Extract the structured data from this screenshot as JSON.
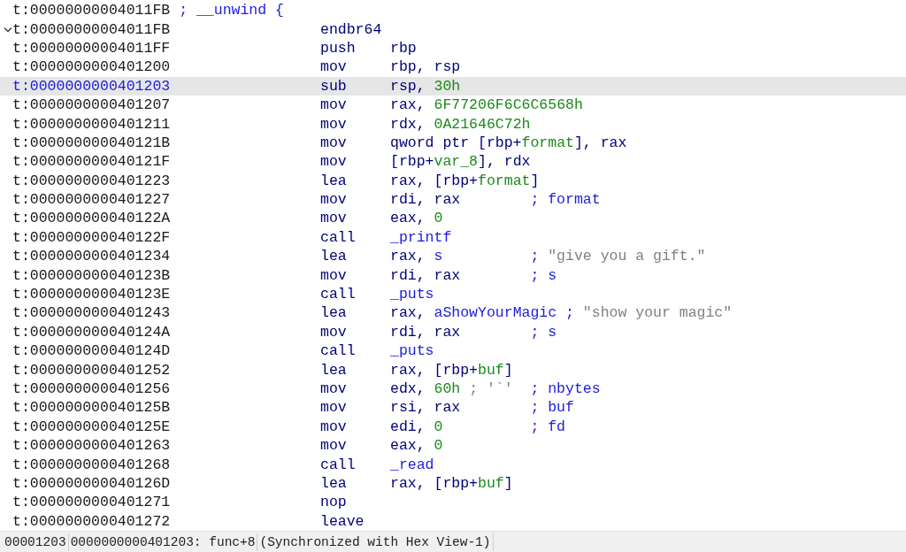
{
  "header": {
    "address": "t:00000000004011FB",
    "comment": "; __unwind {"
  },
  "lines": [
    {
      "address": "t:00000000004011FB",
      "selected": false,
      "expanded": true,
      "mnemonic": "endbr64"
    },
    {
      "address": "t:00000000004011FF",
      "selected": false,
      "mnemonic": "push",
      "operands": [
        {
          "text": "rbp",
          "kind": "reg"
        }
      ]
    },
    {
      "address": "t:0000000000401200",
      "selected": false,
      "mnemonic": "mov",
      "operands": [
        {
          "text": "rbp, rsp",
          "kind": "reg"
        }
      ]
    },
    {
      "address": "t:0000000000401203",
      "selected": true,
      "mnemonic": "sub",
      "operands": [
        {
          "text": "rsp, ",
          "kind": "reg"
        },
        {
          "text": "30h",
          "kind": "num"
        }
      ]
    },
    {
      "address": "t:0000000000401207",
      "selected": false,
      "mnemonic": "mov",
      "operands": [
        {
          "text": "rax, ",
          "kind": "reg"
        },
        {
          "text": "6F77206F6C6C6568h",
          "kind": "num"
        }
      ]
    },
    {
      "address": "t:0000000000401211",
      "selected": false,
      "mnemonic": "mov",
      "operands": [
        {
          "text": "rdx, ",
          "kind": "reg"
        },
        {
          "text": "0A21646C72h",
          "kind": "num"
        }
      ]
    },
    {
      "address": "t:000000000040121B",
      "selected": false,
      "mnemonic": "mov",
      "operands": [
        {
          "text": "qword ptr [rbp+",
          "kind": "reg"
        },
        {
          "text": "format",
          "kind": "num"
        },
        {
          "text": "], rax",
          "kind": "reg"
        }
      ]
    },
    {
      "address": "t:000000000040121F",
      "selected": false,
      "mnemonic": "mov",
      "operands": [
        {
          "text": "[rbp+",
          "kind": "reg"
        },
        {
          "text": "var_8",
          "kind": "num"
        },
        {
          "text": "], rdx",
          "kind": "reg"
        }
      ]
    },
    {
      "address": "t:0000000000401223",
      "selected": false,
      "mnemonic": "lea",
      "operands": [
        {
          "text": "rax, [rbp+",
          "kind": "reg"
        },
        {
          "text": "format",
          "kind": "num"
        },
        {
          "text": "]",
          "kind": "reg"
        }
      ]
    },
    {
      "address": "t:0000000000401227",
      "selected": false,
      "mnemonic": "mov",
      "operands": [
        {
          "text": "rdi, rax",
          "kind": "reg"
        }
      ],
      "comment": [
        {
          "text": "; format",
          "kind": "ref"
        }
      ]
    },
    {
      "address": "t:000000000040122A",
      "selected": false,
      "mnemonic": "mov",
      "operands": [
        {
          "text": "eax, ",
          "kind": "reg"
        },
        {
          "text": "0",
          "kind": "num"
        }
      ]
    },
    {
      "address": "t:000000000040122F",
      "selected": false,
      "mnemonic": "call",
      "operands": [
        {
          "text": "_printf",
          "kind": "sym"
        }
      ]
    },
    {
      "address": "t:0000000000401234",
      "selected": false,
      "mnemonic": "lea",
      "operands": [
        {
          "text": "rax, ",
          "kind": "reg"
        },
        {
          "text": "s",
          "kind": "sym"
        }
      ],
      "comment": [
        {
          "text": "; ",
          "kind": "ref"
        },
        {
          "text": "\"give you a gift.\"",
          "kind": "str"
        }
      ]
    },
    {
      "address": "t:000000000040123B",
      "selected": false,
      "mnemonic": "mov",
      "operands": [
        {
          "text": "rdi, rax",
          "kind": "reg"
        }
      ],
      "comment": [
        {
          "text": "; s",
          "kind": "ref"
        }
      ]
    },
    {
      "address": "t:000000000040123E",
      "selected": false,
      "mnemonic": "call",
      "operands": [
        {
          "text": "_puts",
          "kind": "sym"
        }
      ]
    },
    {
      "address": "t:0000000000401243",
      "selected": false,
      "mnemonic": "lea",
      "operands": [
        {
          "text": "rax, ",
          "kind": "reg"
        },
        {
          "text": "aShowYourMagic",
          "kind": "sym"
        }
      ],
      "comment": [
        {
          "text": "; ",
          "kind": "ref"
        },
        {
          "text": "\"show your magic\"",
          "kind": "str"
        }
      ]
    },
    {
      "address": "t:000000000040124A",
      "selected": false,
      "mnemonic": "mov",
      "operands": [
        {
          "text": "rdi, rax",
          "kind": "reg"
        }
      ],
      "comment": [
        {
          "text": "; s",
          "kind": "ref"
        }
      ]
    },
    {
      "address": "t:000000000040124D",
      "selected": false,
      "mnemonic": "call",
      "operands": [
        {
          "text": "_puts",
          "kind": "sym"
        }
      ]
    },
    {
      "address": "t:0000000000401252",
      "selected": false,
      "mnemonic": "lea",
      "operands": [
        {
          "text": "rax, [rbp+",
          "kind": "reg"
        },
        {
          "text": "buf",
          "kind": "num"
        },
        {
          "text": "]",
          "kind": "reg"
        }
      ]
    },
    {
      "address": "t:0000000000401256",
      "selected": false,
      "mnemonic": "mov",
      "operands": [
        {
          "text": "edx, ",
          "kind": "reg"
        },
        {
          "text": "60h",
          "kind": "num"
        },
        {
          "text": " ; '`'",
          "kind": "str"
        }
      ],
      "comment": [
        {
          "text": "; nbytes",
          "kind": "ref"
        }
      ]
    },
    {
      "address": "t:000000000040125B",
      "selected": false,
      "mnemonic": "mov",
      "operands": [
        {
          "text": "rsi, rax",
          "kind": "reg"
        }
      ],
      "comment": [
        {
          "text": "; buf",
          "kind": "ref"
        }
      ]
    },
    {
      "address": "t:000000000040125E",
      "selected": false,
      "mnemonic": "mov",
      "operands": [
        {
          "text": "edi, ",
          "kind": "reg"
        },
        {
          "text": "0",
          "kind": "num"
        }
      ],
      "comment": [
        {
          "text": "; fd",
          "kind": "ref"
        }
      ]
    },
    {
      "address": "t:0000000000401263",
      "selected": false,
      "mnemonic": "mov",
      "operands": [
        {
          "text": "eax, ",
          "kind": "reg"
        },
        {
          "text": "0",
          "kind": "num"
        }
      ]
    },
    {
      "address": "t:0000000000401268",
      "selected": false,
      "mnemonic": "call",
      "operands": [
        {
          "text": "_read",
          "kind": "sym"
        }
      ]
    },
    {
      "address": "t:000000000040126D",
      "selected": false,
      "mnemonic": "lea",
      "operands": [
        {
          "text": "rax, [rbp+",
          "kind": "reg"
        },
        {
          "text": "buf",
          "kind": "num"
        },
        {
          "text": "]",
          "kind": "reg"
        }
      ]
    },
    {
      "address": "t:0000000000401271",
      "selected": false,
      "mnemonic": "nop"
    },
    {
      "address": "t:0000000000401272",
      "selected": false,
      "mnemonic": "leave"
    }
  ],
  "status_bar": [
    "00001203",
    "0000000000401203: func+8",
    "(Synchronized with Hex View-1)"
  ]
}
